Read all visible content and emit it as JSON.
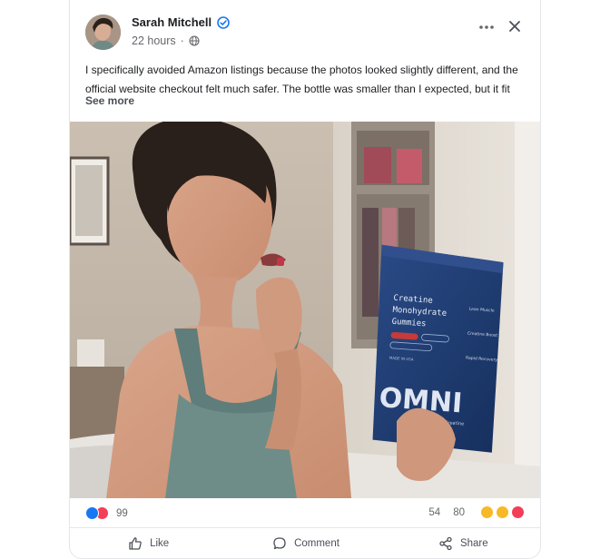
{
  "post": {
    "author": "Sarah Mitchell",
    "time": "22 hours",
    "separator": "·",
    "text": "I specifically avoided Amazon listings because the photos looked slightly different, and the official website checkout felt much safer. The bottle was smaller than I expected, but it fit",
    "see_more": "See more"
  },
  "product": {
    "pouch_title_lines": [
      "Creatine",
      "Monohydrate",
      "Gummies"
    ],
    "brand": "OMNI",
    "brand_sub": "Creatine",
    "side_labels": [
      "Lean Muscle",
      "Creatine Boost",
      "Rapid Recovery"
    ],
    "made_in": "MADE IN USA"
  },
  "stats": {
    "reaction_count": "99",
    "comments_count": "54",
    "shares_count": "80"
  },
  "actions": {
    "like": "Like",
    "comment": "Comment",
    "share": "Share"
  },
  "icons": {
    "more": "more-horizontal-icon",
    "close": "close-icon",
    "verified": "verified-badge-icon",
    "globe": "globe-icon"
  },
  "colors": {
    "verified": "#1877f2",
    "like": "#1877f2",
    "love": "#f33e58",
    "pouch": "#1f3a6e"
  }
}
